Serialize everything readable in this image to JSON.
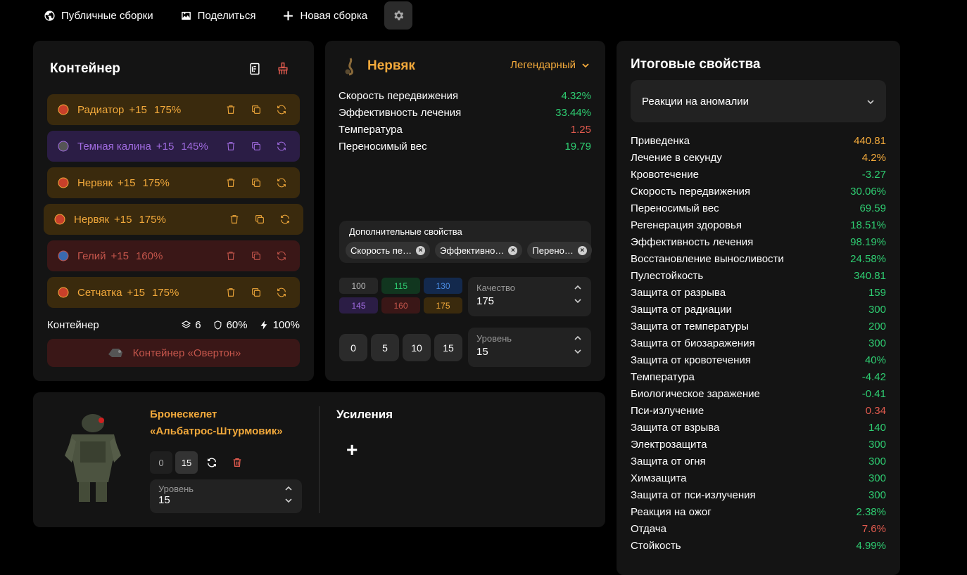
{
  "nav": {
    "public_builds": "Публичные сборки",
    "share": "Поделиться",
    "new_build": "Новая сборка"
  },
  "container": {
    "title": "Контейнер",
    "artifacts": [
      {
        "name": "Радиатор",
        "level": "+15",
        "quality": "175%",
        "color": "orange"
      },
      {
        "name": "Темная калина",
        "level": "+15",
        "quality": "145%",
        "color": "purple"
      },
      {
        "name": "Нервяк",
        "level": "+15",
        "quality": "175%",
        "color": "orange"
      },
      {
        "name": "Нервяк",
        "level": "+15",
        "quality": "175%",
        "color": "orange"
      },
      {
        "name": "Гелий",
        "level": "+15",
        "quality": "160%",
        "color": "red"
      },
      {
        "name": "Сетчатка",
        "level": "+15",
        "quality": "175%",
        "color": "orange"
      }
    ],
    "stats_label": "Контейнер",
    "slots": "6",
    "protection": "60%",
    "efficiency": "100%",
    "container_name": "Контейнер «Овертон»"
  },
  "item": {
    "name": "Нервяк",
    "rarity": "Легендарный",
    "props": [
      {
        "label": "Скорость передвижения",
        "value": "4.32%",
        "color": "green"
      },
      {
        "label": "Эффективность лечения",
        "value": "33.44%",
        "color": "green"
      },
      {
        "label": "Температура",
        "value": "1.25",
        "color": "red"
      },
      {
        "label": "Переносимый вес",
        "value": "19.79",
        "color": "green"
      }
    ],
    "extra_label": "Дополнительные свойства",
    "extra_chips": [
      "Скорость пе…",
      "Эффективно…",
      "Перено…"
    ],
    "quality_presets": [
      {
        "v": "100",
        "bg": "#262626",
        "fg": "#bbbbbb"
      },
      {
        "v": "115",
        "bg": "#11361f",
        "fg": "#2ecc71"
      },
      {
        "v": "130",
        "bg": "#13294d",
        "fg": "#4a8be0"
      },
      {
        "v": "145",
        "bg": "#2b1d45",
        "fg": "#a06be0"
      },
      {
        "v": "160",
        "bg": "#3a1717",
        "fg": "#c4554b"
      },
      {
        "v": "175",
        "bg": "#3a2a0d",
        "fg": "#f2a93b"
      }
    ],
    "quality_label": "Качество",
    "quality_value": "175",
    "level_presets": [
      "0",
      "5",
      "10",
      "15"
    ],
    "level_label": "Уровень",
    "level_value": "15"
  },
  "result": {
    "title": "Итоговые свойства",
    "filter": "Реакции на аномалии",
    "props": [
      {
        "label": "Приведенка",
        "value": "440.81",
        "color": "orange"
      },
      {
        "label": "Лечение в секунду",
        "value": "4.2%",
        "color": "orange"
      },
      {
        "label": "Кровотечение",
        "value": "-3.27",
        "color": "green"
      },
      {
        "label": "Скорость передвижения",
        "value": "30.06%",
        "color": "green"
      },
      {
        "label": "Переносимый вес",
        "value": "69.59",
        "color": "green"
      },
      {
        "label": "Регенерация здоровья",
        "value": "18.51%",
        "color": "green"
      },
      {
        "label": "Эффективность лечения",
        "value": "98.19%",
        "color": "green"
      },
      {
        "label": "Восстановление выносливости",
        "value": "24.58%",
        "color": "green"
      },
      {
        "label": "Пулестойкость",
        "value": "340.81",
        "color": "green"
      },
      {
        "label": "Защита от разрыва",
        "value": "159",
        "color": "green"
      },
      {
        "label": "Защита от радиации",
        "value": "300",
        "color": "green"
      },
      {
        "label": "Защита от температуры",
        "value": "200",
        "color": "green"
      },
      {
        "label": "Защита от биозаражения",
        "value": "300",
        "color": "green"
      },
      {
        "label": "Защита от кровотечения",
        "value": "40%",
        "color": "green"
      },
      {
        "label": "Температура",
        "value": "-4.42",
        "color": "green"
      },
      {
        "label": "Биологическое заражение",
        "value": "-0.41",
        "color": "green"
      },
      {
        "label": "Пси-излучение",
        "value": "0.34",
        "color": "red"
      },
      {
        "label": "Защита от взрыва",
        "value": "140",
        "color": "green"
      },
      {
        "label": "Электрозащита",
        "value": "300",
        "color": "green"
      },
      {
        "label": "Защита от огня",
        "value": "300",
        "color": "green"
      },
      {
        "label": "Химзащита",
        "value": "300",
        "color": "green"
      },
      {
        "label": "Защита от пси-излучения",
        "value": "300",
        "color": "green"
      },
      {
        "label": "Реакция на ожог",
        "value": "2.38%",
        "color": "green"
      },
      {
        "label": "Отдача",
        "value": "7.6%",
        "color": "red"
      },
      {
        "label": "Стойкость",
        "value": "4.99%",
        "color": "green"
      }
    ]
  },
  "armor": {
    "name_line1": "Бронескелет",
    "name_line2": "«Альбатрос-Штурмовик»",
    "btn_a": "0",
    "btn_b": "15",
    "level_label": "Уровень",
    "level_value": "15",
    "boosts_title": "Усиления",
    "add": "+"
  }
}
